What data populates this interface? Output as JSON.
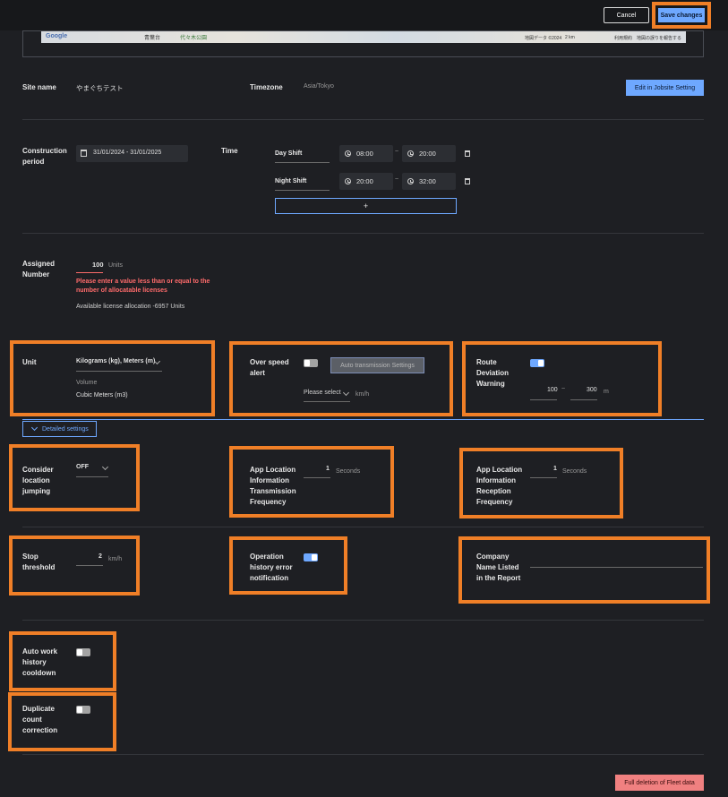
{
  "header": {
    "cancel_label": "Cancel",
    "save_label": "Save changes"
  },
  "map": {
    "attribution": "地図データ ©2024",
    "scale": "2 km",
    "terms": "利用規約",
    "report": "地図の誤りを報告する",
    "place1": "青葉台",
    "place2": "代々木公園",
    "google": "Google"
  },
  "site": {
    "name_label": "Site name",
    "name_value": "やまぐちテスト",
    "timezone_label": "Timezone",
    "timezone_value": "Asia/Tokyo",
    "edit_button": "Edit in Jobsite Setting"
  },
  "construction": {
    "label": "Construction period",
    "period_value": "31/01/2024 - 31/01/2025",
    "time_label": "Time",
    "shifts": [
      {
        "name": "Day Shift",
        "start": "08:00",
        "end": "20:00"
      },
      {
        "name": "Night Shift",
        "start": "20:00",
        "end": "32:00"
      }
    ],
    "separator": "~",
    "add_label": "+"
  },
  "assigned": {
    "label": "Assigned Number",
    "value": "100",
    "unit": "Units",
    "error": "Please enter a value less than or equal to the number of allocatable licenses",
    "available": "Available license allocation -6957 Units"
  },
  "unit": {
    "label": "Unit",
    "weight_value": "Kilograms (kg), Meters (m)",
    "volume_label": "Volume",
    "volume_value": "Cubic Meters (m3)"
  },
  "overspeed": {
    "label": "Over speed alert",
    "button": "Auto transmission Settings",
    "select_placeholder": "Please select",
    "unit": "km/h",
    "enabled": false
  },
  "route": {
    "label": "Route Deviation Warning",
    "min": "100",
    "max": "300",
    "separator": "~",
    "unit": "m",
    "enabled": true
  },
  "detailed": {
    "label": "Detailed settings"
  },
  "jumping": {
    "label": "Consider location jumping",
    "value": "OFF"
  },
  "transmission": {
    "label": "App Location Information Transmission Frequency",
    "value": "1",
    "unit": "Seconds"
  },
  "reception": {
    "label": "App Location Information Reception Frequency",
    "value": "1",
    "unit": "Seconds"
  },
  "stop": {
    "label": "Stop threshold",
    "value": "2",
    "unit": "km/h"
  },
  "operation": {
    "label": "Operation history error notification",
    "enabled": true
  },
  "company": {
    "label": "Company Name Listed in the Report",
    "value": ""
  },
  "cooldown": {
    "label": "Auto work history cooldown",
    "enabled": false
  },
  "duplicate": {
    "label": "Duplicate count correction",
    "enabled": false
  },
  "danger": {
    "label": "Full deletion of Fleet data"
  },
  "colors": {
    "accent": "#6ea8ff",
    "highlight": "#f07f27",
    "error": "#ff6b6b",
    "danger_bg": "#f08080"
  }
}
